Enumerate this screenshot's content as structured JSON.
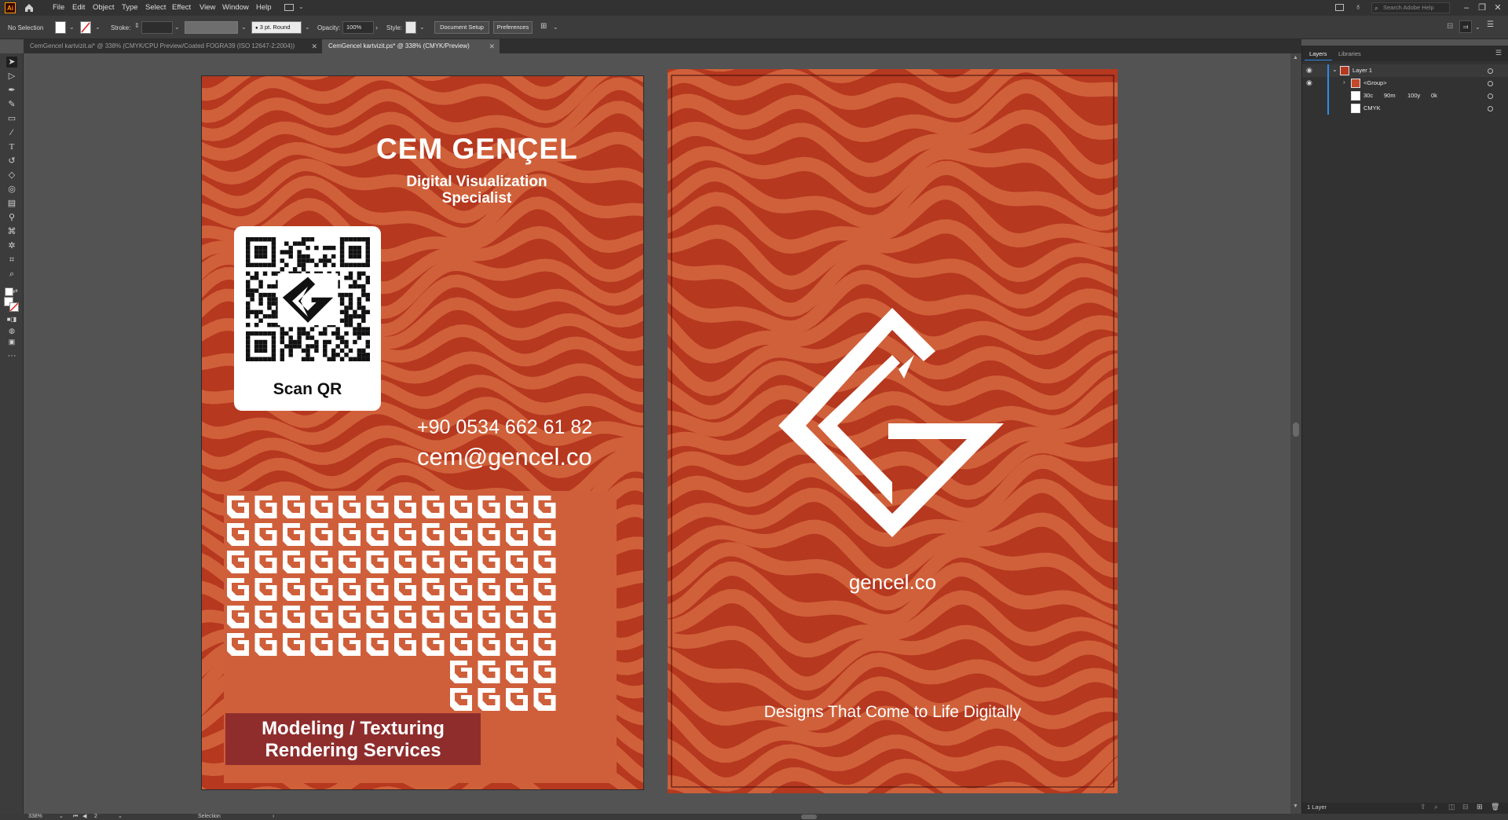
{
  "menubar": {
    "app_logo": "Ai",
    "items": [
      "File",
      "Edit",
      "Object",
      "Type",
      "Select",
      "Effect",
      "View",
      "Window",
      "Help"
    ],
    "search_placeholder": "Search Adobe Help"
  },
  "controlbar": {
    "selection": "No Selection",
    "stroke_label": "Stroke:",
    "brush": "3 pt. Round",
    "opacity_label": "Opacity:",
    "opacity_value": "100%",
    "style_label": "Style:",
    "document_setup": "Document Setup",
    "preferences": "Preferences"
  },
  "tabs": [
    {
      "label": "CemGencel kartvizit.ai* @ 338% (CMYK/CPU Preview/Coated FOGRA39 (ISO 12647-2:2004))"
    },
    {
      "label": "CemGencel kartvizit.ps* @ 338% (CMYK/Preview)"
    }
  ],
  "card_front": {
    "name": "CEM GENÇEL",
    "title_line1": "Digital Visualization",
    "title_line2": "Specialist",
    "qr_label": "Scan QR",
    "phone": "+90 0534 662 61 82",
    "email": "cem@gencel.co",
    "services_line1": "Modeling / Texturing",
    "services_line2": "Rendering Services"
  },
  "card_back": {
    "domain": "gencel.co",
    "tagline": "Designs That Come to Life Digitally"
  },
  "colors": {
    "card_dark": "#b5381f",
    "card_light": "#d0603a",
    "services_box": "#8f2d2d",
    "accent_blue": "#2d8ceb"
  },
  "panel": {
    "tabs": [
      "Layers",
      "Libraries"
    ],
    "layers": [
      {
        "name": "Layer 1"
      },
      {
        "name": "<Group>"
      },
      {
        "name": "30c",
        "extra": [
          "90m",
          "100y",
          "0k"
        ]
      },
      {
        "name": "CMYK"
      }
    ],
    "footer": "1 Layer"
  },
  "statusbar": {
    "zoom": "338%",
    "artboard": "2",
    "tool": "Selection"
  }
}
